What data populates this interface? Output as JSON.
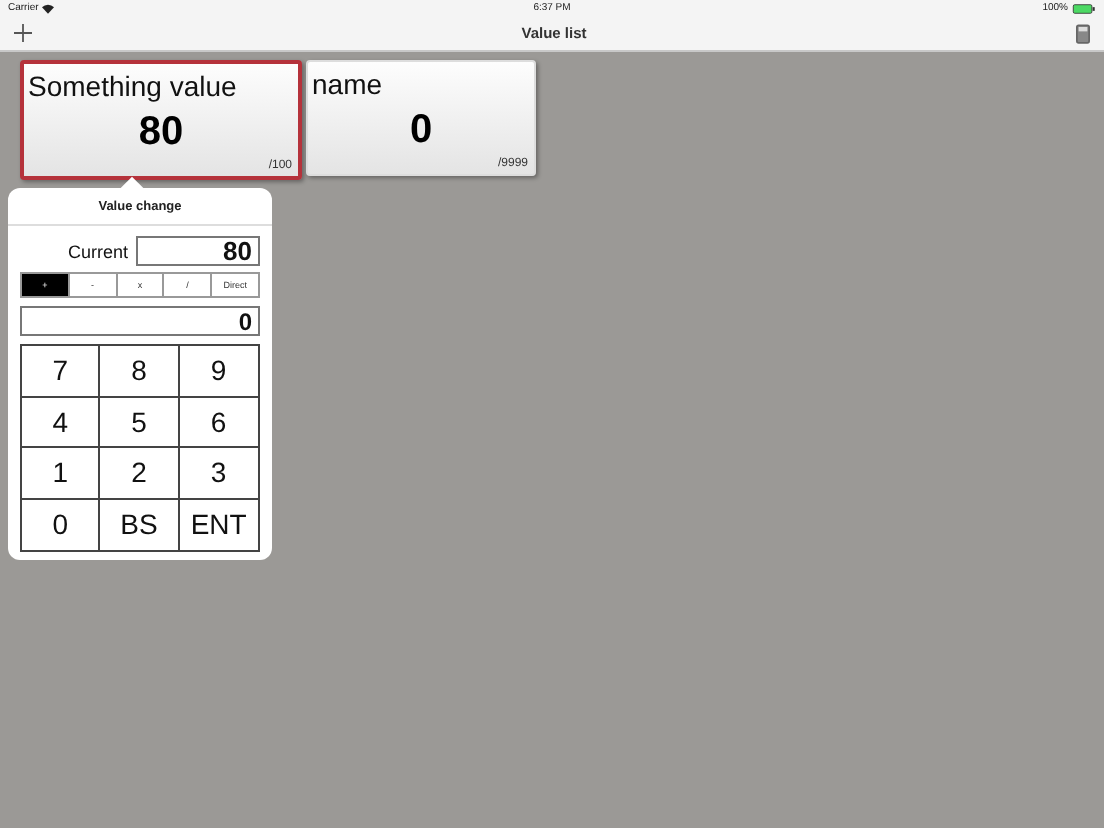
{
  "status_bar": {
    "carrier": "Carrier",
    "time": "6:37 PM",
    "battery": "100%"
  },
  "nav": {
    "title": "Value list"
  },
  "cards": [
    {
      "name": "Something value",
      "value": "80",
      "max": "/100",
      "selected": true
    },
    {
      "name": "name",
      "value": "0",
      "max": "/9999",
      "selected": false
    }
  ],
  "popover": {
    "title": "Value change",
    "current_label": "Current",
    "current_value": "80",
    "operations": [
      {
        "label": "+",
        "selected": true
      },
      {
        "label": "-",
        "selected": false
      },
      {
        "label": "x",
        "selected": false
      },
      {
        "label": "/",
        "selected": false
      },
      {
        "label": "Direct",
        "selected": false
      }
    ],
    "entry": "0",
    "keys": [
      "7",
      "8",
      "9",
      "4",
      "5",
      "6",
      "1",
      "2",
      "3",
      "0",
      "BS",
      "ENT"
    ]
  }
}
